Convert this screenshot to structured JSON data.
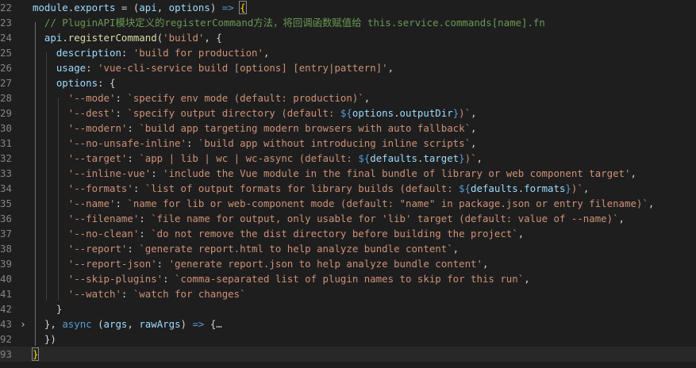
{
  "lines": [
    {
      "num": "22",
      "fold": "",
      "segs": [
        [
          "var",
          "module"
        ],
        [
          "punc",
          "."
        ],
        [
          "var",
          "exports"
        ],
        [
          "punc",
          " = ("
        ],
        [
          "var",
          "api"
        ],
        [
          "punc",
          ", "
        ],
        [
          "var",
          "options"
        ],
        [
          "punc",
          ") "
        ],
        [
          "kw",
          "=>"
        ],
        [
          "punc",
          " "
        ],
        [
          "brk",
          "{"
        ]
      ]
    },
    {
      "num": "23",
      "fold": "",
      "segs": [
        [
          "punc",
          "  "
        ],
        [
          "cm",
          "// PluginAPI模块定义的registerCommand方法，将回调函数赋值给 this.service.commands[name].fn"
        ]
      ]
    },
    {
      "num": "24",
      "fold": "",
      "segs": [
        [
          "punc",
          "  "
        ],
        [
          "var",
          "api"
        ],
        [
          "punc",
          "."
        ],
        [
          "fn",
          "registerCommand"
        ],
        [
          "punc",
          "("
        ],
        [
          "str",
          "'build'"
        ],
        [
          "punc",
          ", {"
        ]
      ]
    },
    {
      "num": "25",
      "fold": "",
      "segs": [
        [
          "punc",
          "    "
        ],
        [
          "var",
          "description"
        ],
        [
          "punc",
          ": "
        ],
        [
          "str",
          "'build for production'"
        ],
        [
          "punc",
          ","
        ]
      ]
    },
    {
      "num": "26",
      "fold": "",
      "segs": [
        [
          "punc",
          "    "
        ],
        [
          "var",
          "usage"
        ],
        [
          "punc",
          ": "
        ],
        [
          "str",
          "'vue-cli-service build [options] [entry|pattern]'"
        ],
        [
          "punc",
          ","
        ]
      ]
    },
    {
      "num": "27",
      "fold": "",
      "segs": [
        [
          "punc",
          "    "
        ],
        [
          "var",
          "options"
        ],
        [
          "punc",
          ": {"
        ]
      ]
    },
    {
      "num": "28",
      "fold": "",
      "segs": [
        [
          "punc",
          "      "
        ],
        [
          "str",
          "'--mode'"
        ],
        [
          "punc",
          ": "
        ],
        [
          "str",
          "`specify env mode (default: production)`"
        ],
        [
          "punc",
          ","
        ]
      ]
    },
    {
      "num": "29",
      "fold": "",
      "segs": [
        [
          "punc",
          "      "
        ],
        [
          "str",
          "'--dest'"
        ],
        [
          "punc",
          ": "
        ],
        [
          "str",
          "`specify output directory (default: "
        ],
        [
          "tpl",
          "${"
        ],
        [
          "var",
          "options"
        ],
        [
          "punc",
          "."
        ],
        [
          "var",
          "outputDir"
        ],
        [
          "tpl",
          "}"
        ],
        [
          "str",
          ")`"
        ],
        [
          "punc",
          ","
        ]
      ]
    },
    {
      "num": "30",
      "fold": "",
      "segs": [
        [
          "punc",
          "      "
        ],
        [
          "str",
          "'--modern'"
        ],
        [
          "punc",
          ": "
        ],
        [
          "str",
          "`build app targeting modern browsers with auto fallback`"
        ],
        [
          "punc",
          ","
        ]
      ]
    },
    {
      "num": "31",
      "fold": "",
      "segs": [
        [
          "punc",
          "      "
        ],
        [
          "str",
          "'--no-unsafe-inline'"
        ],
        [
          "punc",
          ": "
        ],
        [
          "str",
          "`build app without introducing inline scripts`"
        ],
        [
          "punc",
          ","
        ]
      ]
    },
    {
      "num": "32",
      "fold": "",
      "segs": [
        [
          "punc",
          "      "
        ],
        [
          "str",
          "'--target'"
        ],
        [
          "punc",
          ": "
        ],
        [
          "str",
          "`app | lib | wc | wc-async (default: "
        ],
        [
          "tpl",
          "${"
        ],
        [
          "var",
          "defaults"
        ],
        [
          "punc",
          "."
        ],
        [
          "var",
          "target"
        ],
        [
          "tpl",
          "}"
        ],
        [
          "str",
          ")`"
        ],
        [
          "punc",
          ","
        ]
      ]
    },
    {
      "num": "33",
      "fold": "",
      "segs": [
        [
          "punc",
          "      "
        ],
        [
          "str",
          "'--inline-vue'"
        ],
        [
          "punc",
          ": "
        ],
        [
          "str",
          "'include the Vue module in the final bundle of library or web component target'"
        ],
        [
          "punc",
          ","
        ]
      ]
    },
    {
      "num": "34",
      "fold": "",
      "segs": [
        [
          "punc",
          "      "
        ],
        [
          "str",
          "'--formats'"
        ],
        [
          "punc",
          ": "
        ],
        [
          "str",
          "`list of output formats for library builds (default: "
        ],
        [
          "tpl",
          "${"
        ],
        [
          "var",
          "defaults"
        ],
        [
          "punc",
          "."
        ],
        [
          "var",
          "formats"
        ],
        [
          "tpl",
          "}"
        ],
        [
          "str",
          ")`"
        ],
        [
          "punc",
          ","
        ]
      ]
    },
    {
      "num": "35",
      "fold": "",
      "segs": [
        [
          "punc",
          "      "
        ],
        [
          "str",
          "'--name'"
        ],
        [
          "punc",
          ": "
        ],
        [
          "str",
          "`name for lib or web-component mode (default: \"name\" in package.json or entry filename)`"
        ],
        [
          "punc",
          ","
        ]
      ]
    },
    {
      "num": "36",
      "fold": "",
      "segs": [
        [
          "punc",
          "      "
        ],
        [
          "str",
          "'--filename'"
        ],
        [
          "punc",
          ": "
        ],
        [
          "str",
          "`file name for output, only usable for 'lib' target (default: value of --name)`"
        ],
        [
          "punc",
          ","
        ]
      ]
    },
    {
      "num": "37",
      "fold": "",
      "segs": [
        [
          "punc",
          "      "
        ],
        [
          "str",
          "'--no-clean'"
        ],
        [
          "punc",
          ": "
        ],
        [
          "str",
          "`do not remove the dist directory before building the project`"
        ],
        [
          "punc",
          ","
        ]
      ]
    },
    {
      "num": "38",
      "fold": "",
      "segs": [
        [
          "punc",
          "      "
        ],
        [
          "str",
          "'--report'"
        ],
        [
          "punc",
          ": "
        ],
        [
          "str",
          "`generate report.html to help analyze bundle content`"
        ],
        [
          "punc",
          ","
        ]
      ]
    },
    {
      "num": "39",
      "fold": "",
      "segs": [
        [
          "punc",
          "      "
        ],
        [
          "str",
          "'--report-json'"
        ],
        [
          "punc",
          ": "
        ],
        [
          "str",
          "'generate report.json to help analyze bundle content'"
        ],
        [
          "punc",
          ","
        ]
      ]
    },
    {
      "num": "40",
      "fold": "",
      "segs": [
        [
          "punc",
          "      "
        ],
        [
          "str",
          "'--skip-plugins'"
        ],
        [
          "punc",
          ": "
        ],
        [
          "str",
          "`comma-separated list of plugin names to skip for this run`"
        ],
        [
          "punc",
          ","
        ]
      ]
    },
    {
      "num": "41",
      "fold": "",
      "segs": [
        [
          "punc",
          "      "
        ],
        [
          "str",
          "'--watch'"
        ],
        [
          "punc",
          ": "
        ],
        [
          "str",
          "`watch for changes`"
        ]
      ]
    },
    {
      "num": "42",
      "fold": "",
      "segs": [
        [
          "punc",
          "    }"
        ]
      ]
    },
    {
      "num": "43",
      "fold": "›",
      "segs": [
        [
          "punc",
          "  }, "
        ],
        [
          "kw",
          "async"
        ],
        [
          "punc",
          " ("
        ],
        [
          "var",
          "args"
        ],
        [
          "punc",
          ", "
        ],
        [
          "var",
          "rawArgs"
        ],
        [
          "punc",
          ") "
        ],
        [
          "kw",
          "=>"
        ],
        [
          "punc",
          " {"
        ],
        [
          "ell",
          "…"
        ]
      ]
    },
    {
      "num": "92",
      "fold": "",
      "segs": [
        [
          "punc",
          "  })"
        ]
      ]
    },
    {
      "num": "93",
      "fold": "",
      "segs": [
        [
          "brk",
          "}"
        ]
      ]
    }
  ]
}
